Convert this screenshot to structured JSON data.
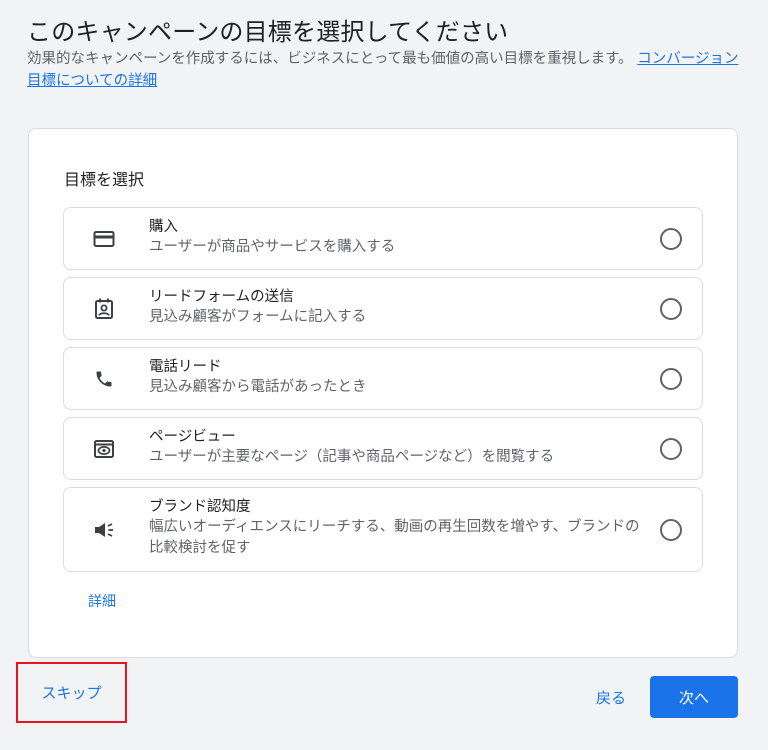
{
  "header": {
    "title": "このキャンペーンの目標を選択してください",
    "description": "効果的なキャンペーンを作成するには、ビジネスにとって最も価値の高い目標を重視します。",
    "link_text": "コンバージョン目標についての詳細"
  },
  "card": {
    "heading": "目標を選択",
    "details_link": "詳細",
    "options": [
      {
        "title": "購入",
        "description": "ユーザーが商品やサービスを購入する",
        "icon": "credit-card-icon",
        "selected": false
      },
      {
        "title": "リードフォームの送信",
        "description": "見込み顧客がフォームに記入する",
        "icon": "contact-form-icon",
        "selected": false
      },
      {
        "title": "電話リード",
        "description": "見込み顧客から電話があったとき",
        "icon": "phone-icon",
        "selected": false
      },
      {
        "title": "ページビュー",
        "description": "ユーザーが主要なページ（記事や商品ページなど）を閲覧する",
        "icon": "page-view-icon",
        "selected": false
      },
      {
        "title": "ブランド認知度",
        "description": "幅広いオーディエンスにリーチする、動画の再生回数を増やす、ブランドの比較検討を促す",
        "icon": "megaphone-icon",
        "selected": false
      }
    ]
  },
  "footer": {
    "skip_label": "スキップ",
    "back_label": "戻る",
    "next_label": "次へ"
  },
  "colors": {
    "accent": "#1a73e8",
    "highlight_border": "#e8141f"
  }
}
